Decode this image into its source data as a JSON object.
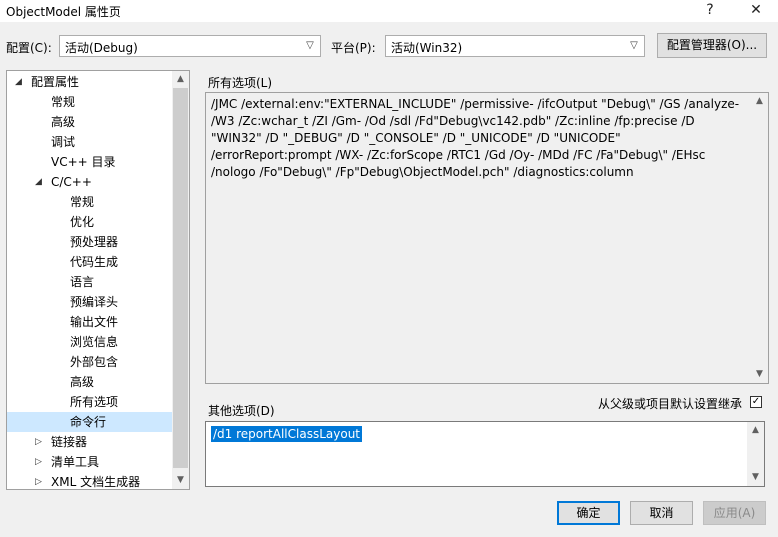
{
  "window": {
    "title": "ObjectModel 属性页",
    "help_label": "?",
    "close_label": "✕"
  },
  "config": {
    "label": "配置(C):",
    "value": "活动(Debug)"
  },
  "platform": {
    "label": "平台(P):",
    "value": "活动(Win32)"
  },
  "config_manager_label": "配置管理器(O)...",
  "tree": {
    "items": [
      {
        "label": "配置属性",
        "twisty": "◢"
      },
      {
        "label": "常规"
      },
      {
        "label": "高级"
      },
      {
        "label": "调试"
      },
      {
        "label": "VC++ 目录"
      },
      {
        "label": "C/C++",
        "twisty": "◢"
      },
      {
        "label": "常规"
      },
      {
        "label": "优化"
      },
      {
        "label": "预处理器"
      },
      {
        "label": "代码生成"
      },
      {
        "label": "语言"
      },
      {
        "label": "预编译头"
      },
      {
        "label": "输出文件"
      },
      {
        "label": "浏览信息"
      },
      {
        "label": "外部包含"
      },
      {
        "label": "高级"
      },
      {
        "label": "所有选项"
      },
      {
        "label": "命令行"
      },
      {
        "label": "链接器",
        "twisty": "▷"
      },
      {
        "label": "清单工具",
        "twisty": "▷"
      },
      {
        "label": "XML 文档生成器",
        "twisty": "▷"
      }
    ]
  },
  "all_options": {
    "label": "所有选项(L)",
    "text": "/JMC /external:env:\"EXTERNAL_INCLUDE\" /permissive- /ifcOutput \"Debug\\\" /GS /analyze- /W3 /Zc:wchar_t /ZI /Gm- /Od /sdl /Fd\"Debug\\vc142.pdb\" /Zc:inline /fp:precise /D \"WIN32\" /D \"_DEBUG\" /D \"_CONSOLE\" /D \"_UNICODE\" /D \"UNICODE\" /errorReport:prompt /WX- /Zc:forScope /RTC1 /Gd /Oy- /MDd /FC /Fa\"Debug\\\" /EHsc /nologo /Fo\"Debug\\\" /Fp\"Debug\\ObjectModel.pch\" /diagnostics:column"
  },
  "other_options": {
    "label": "其他选项(D)",
    "value": "/d1 reportAllClassLayout"
  },
  "inherit": {
    "label": "从父级或项目默认设置继承",
    "checked": true
  },
  "buttons": {
    "ok": "确定",
    "cancel": "取消",
    "apply": "应用(A)"
  }
}
